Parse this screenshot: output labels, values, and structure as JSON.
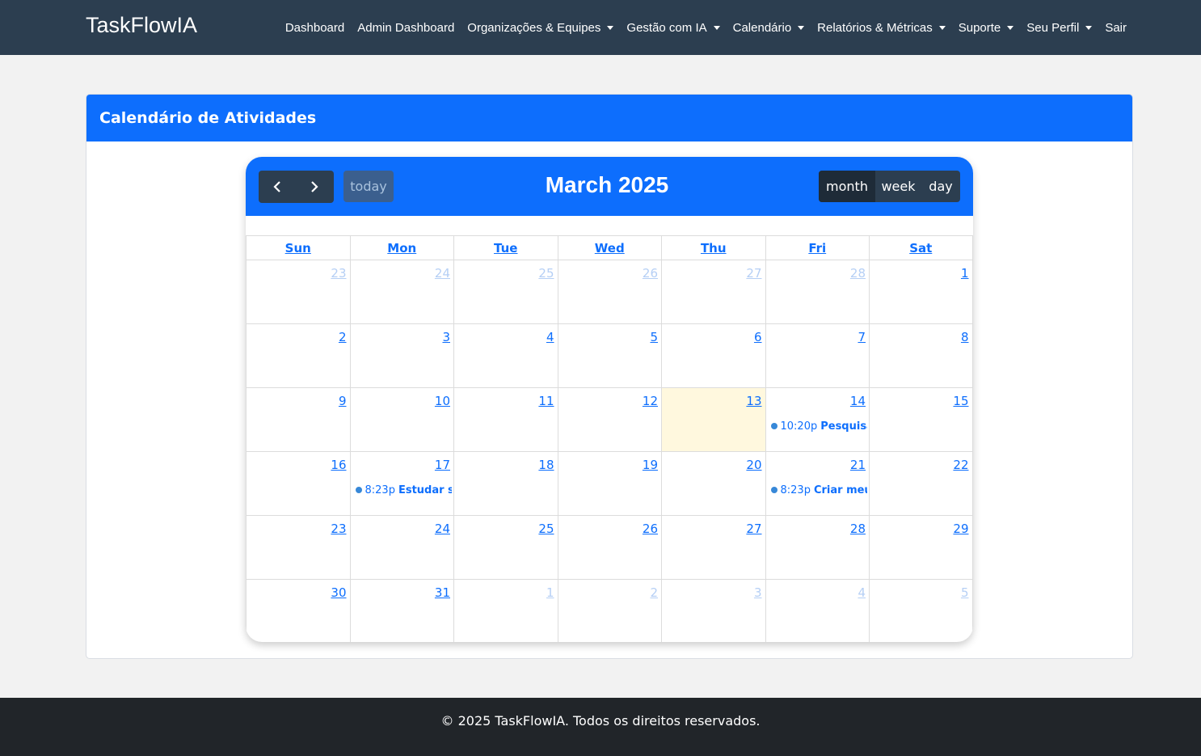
{
  "navbar": {
    "brand": "TaskFlowIA",
    "items": [
      {
        "label": "Dashboard",
        "dropdown": false
      },
      {
        "label": "Admin Dashboard",
        "dropdown": false
      },
      {
        "label": "Organizações & Equipes",
        "dropdown": true
      },
      {
        "label": "Gestão com IA",
        "dropdown": true
      },
      {
        "label": "Calendário",
        "dropdown": true
      },
      {
        "label": "Relatórios & Métricas",
        "dropdown": true
      },
      {
        "label": "Suporte",
        "dropdown": true
      },
      {
        "label": "Seu Perfil",
        "dropdown": true
      },
      {
        "label": "Sair",
        "dropdown": false
      }
    ]
  },
  "card": {
    "title": "Calendário de Atividades"
  },
  "calendar": {
    "title": "March 2025",
    "prev_icon": "‹",
    "next_icon": "›",
    "today_label": "today",
    "views": [
      "month",
      "week",
      "day"
    ],
    "active_view": "month",
    "day_headers": [
      "Sun",
      "Mon",
      "Tue",
      "Wed",
      "Thu",
      "Fri",
      "Sat"
    ],
    "weeks": [
      [
        {
          "n": "23",
          "other": true
        },
        {
          "n": "24",
          "other": true
        },
        {
          "n": "25",
          "other": true
        },
        {
          "n": "26",
          "other": true
        },
        {
          "n": "27",
          "other": true
        },
        {
          "n": "28",
          "other": true
        },
        {
          "n": "1"
        }
      ],
      [
        {
          "n": "2"
        },
        {
          "n": "3"
        },
        {
          "n": "4"
        },
        {
          "n": "5"
        },
        {
          "n": "6"
        },
        {
          "n": "7"
        },
        {
          "n": "8"
        }
      ],
      [
        {
          "n": "9"
        },
        {
          "n": "10"
        },
        {
          "n": "11"
        },
        {
          "n": "12"
        },
        {
          "n": "13",
          "today": true
        },
        {
          "n": "14",
          "event": {
            "time": "10:20p",
            "title": "Pesquisar"
          }
        },
        {
          "n": "15"
        }
      ],
      [
        {
          "n": "16"
        },
        {
          "n": "17",
          "event": {
            "time": "8:23p",
            "title": "Estudar sob"
          }
        },
        {
          "n": "18"
        },
        {
          "n": "19"
        },
        {
          "n": "20"
        },
        {
          "n": "21",
          "event": {
            "time": "8:23p",
            "title": "Criar meus"
          }
        },
        {
          "n": "22"
        }
      ],
      [
        {
          "n": "23"
        },
        {
          "n": "24"
        },
        {
          "n": "25"
        },
        {
          "n": "26"
        },
        {
          "n": "27"
        },
        {
          "n": "28"
        },
        {
          "n": "29"
        }
      ],
      [
        {
          "n": "30"
        },
        {
          "n": "31"
        },
        {
          "n": "1",
          "other": true
        },
        {
          "n": "2",
          "other": true
        },
        {
          "n": "3",
          "other": true
        },
        {
          "n": "4",
          "other": true
        },
        {
          "n": "5",
          "other": true
        }
      ]
    ],
    "colors": {
      "header": "#0d6efd",
      "today_bg": "#fff8de",
      "event_dot": "#3788d8"
    }
  },
  "footer": {
    "text": "© 2025 TaskFlowIA. Todos os direitos reservados."
  }
}
